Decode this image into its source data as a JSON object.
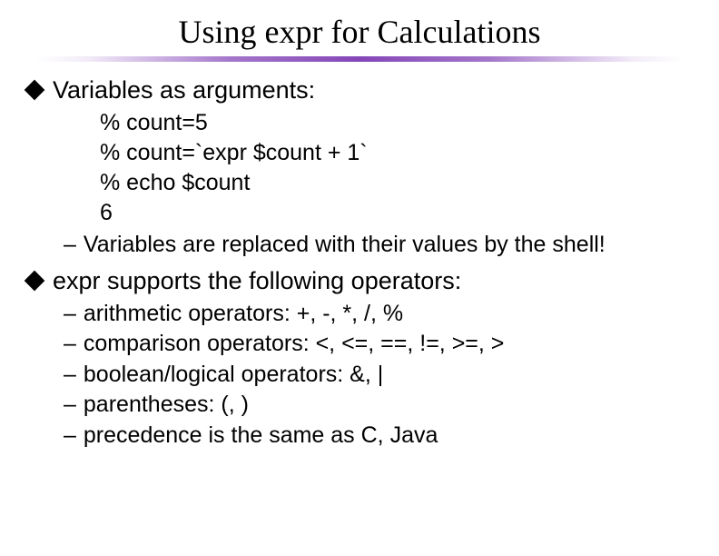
{
  "title": "Using expr for Calculations",
  "bullet1_text": "Variables as arguments:",
  "code": {
    "l1": "% count=5",
    "l2": "% count=`expr $count + 1`",
    "l3": "% echo $count",
    "l4": "6"
  },
  "note1": "Variables are replaced with their values by the shell!",
  "bullet2_text": "expr supports the following operators:",
  "ops": {
    "l1": "arithmetic operators: +, -, *, /, %",
    "l2": "comparison operators: <, <=, ==, !=, >=, >",
    "l3": "boolean/logical operators: &, |",
    "l4": "parentheses: (, )",
    "l5": "precedence is the same as C, Java"
  }
}
